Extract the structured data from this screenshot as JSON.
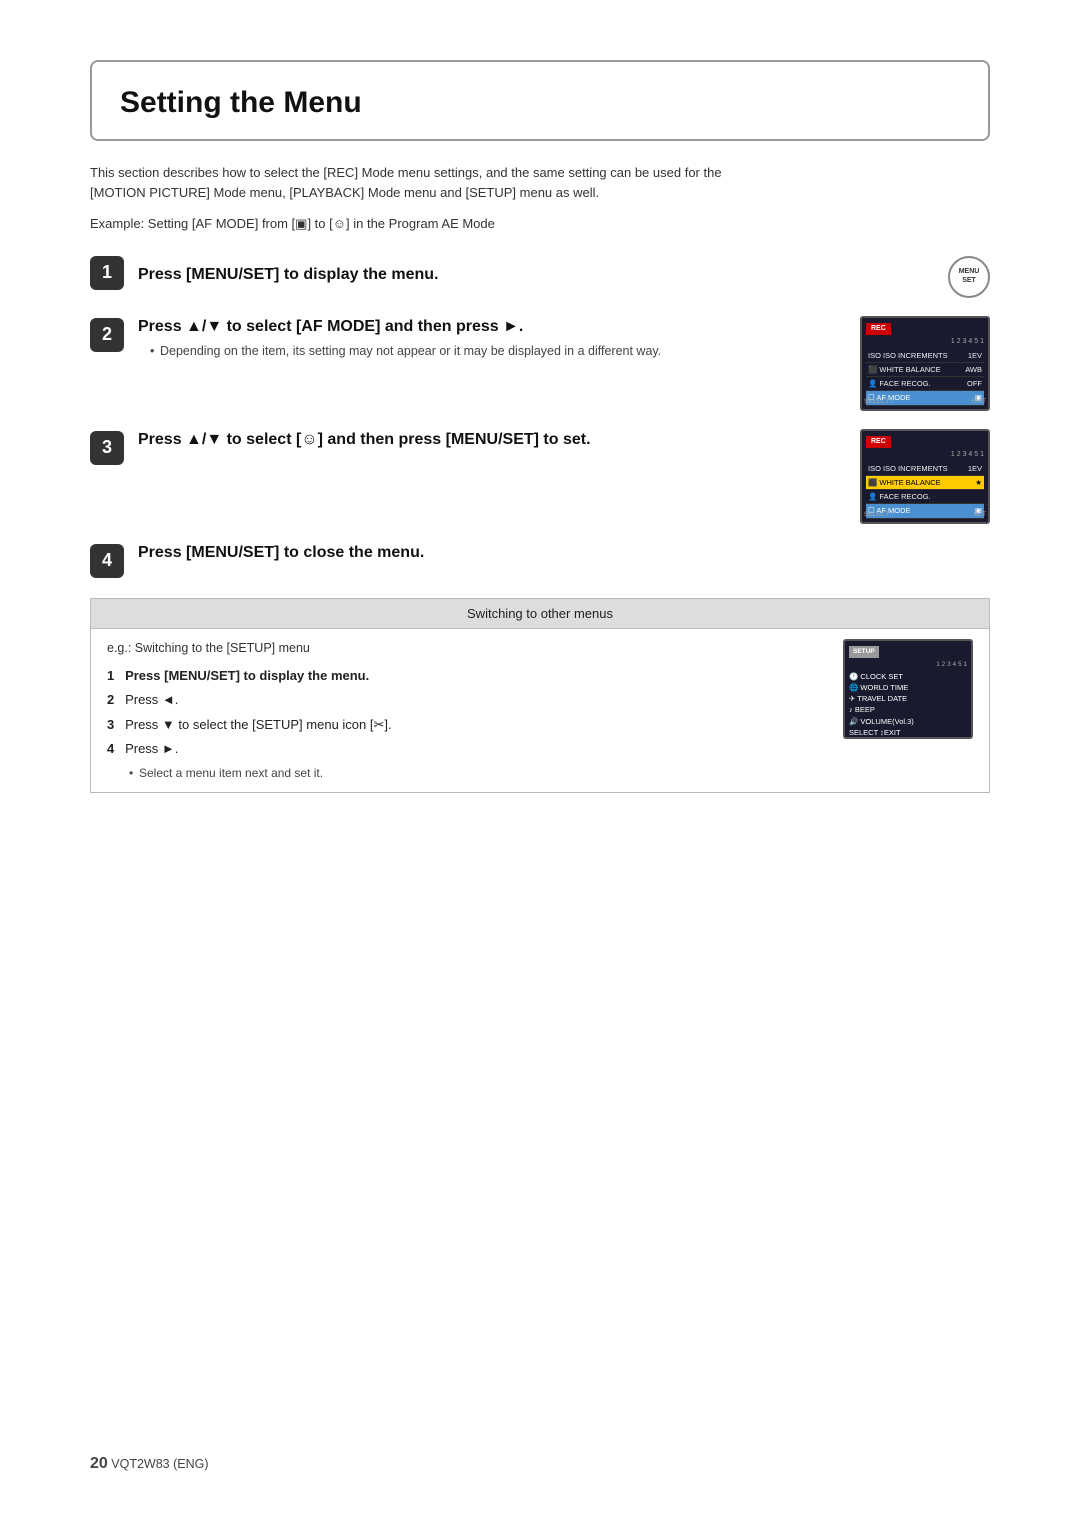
{
  "page": {
    "title": "Setting the Menu",
    "intro": "This section describes how to select the [REC] Mode menu settings, and the same setting can be used for the [MOTION PICTURE] Mode menu, [PLAYBACK] Mode menu and [SETUP] menu as well.",
    "example": "Example: Setting [AF MODE] from [▣] to [☺] in the Program AE Mode",
    "steps": [
      {
        "number": "1",
        "title": "Press [MENU/SET] to display the menu.",
        "note": null,
        "has_image": true,
        "image_type": "menu_icon"
      },
      {
        "number": "2",
        "title": "Press ▲/▼ to select [AF MODE] and then press ►.",
        "note": "Depending on the item, its setting may not appear or it may be displayed in a different way.",
        "has_image": true,
        "image_type": "camera_screen_1"
      },
      {
        "number": "3",
        "title": "Press ▲/▼ to select [☺] and then press [MENU/SET] to set.",
        "note": null,
        "has_image": true,
        "image_type": "camera_screen_2"
      },
      {
        "number": "4",
        "title": "Press [MENU/SET] to close the menu.",
        "note": null,
        "has_image": false
      }
    ],
    "switching_box": {
      "title": "Switching to other menus",
      "eg": "e.g.: Switching to the [SETUP] menu",
      "sub_steps": [
        {
          "num": "1",
          "text": "Press [MENU/SET] to display the menu.",
          "bold": true
        },
        {
          "num": "2",
          "text": "Press ◄.",
          "bold": false
        },
        {
          "num": "3",
          "text": "Press ▼ to select the [SETUP] menu icon [✂].",
          "bold": false
        },
        {
          "num": "4",
          "text": "Press ►.",
          "bold": false,
          "note": "Select a menu item next and set it."
        }
      ]
    },
    "footer": {
      "page_number": "20",
      "code": "VQT2W83 (ENG)"
    }
  }
}
